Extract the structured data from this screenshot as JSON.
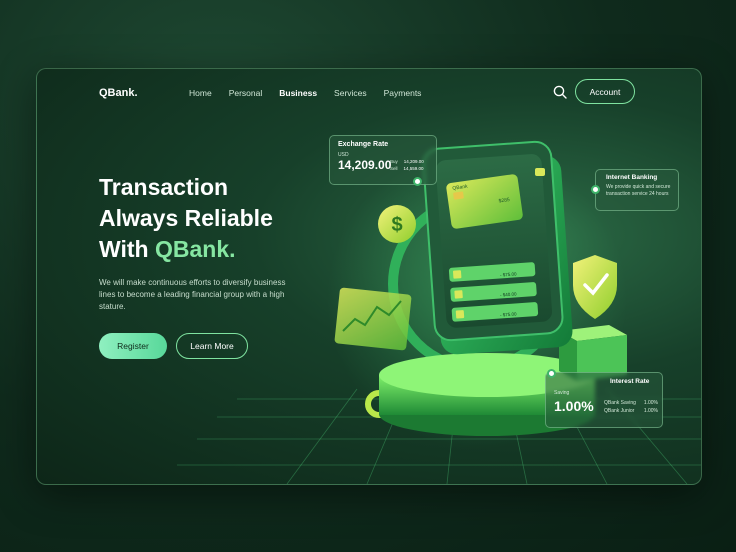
{
  "nav": {
    "logo": "QBank.",
    "items": [
      "Home",
      "Personal",
      "Business",
      "Services",
      "Payments"
    ],
    "active": "Business",
    "account_label": "Account"
  },
  "hero": {
    "title_line1": "Transaction",
    "title_line2": "Always Reliable",
    "title_line3_prefix": "With ",
    "title_line3_accent": "QBank.",
    "description": "We will make continuous efforts to diversify business lines to become a leading financial group with a high stature.",
    "register_label": "Register",
    "learn_more_label": "Learn More"
  },
  "exchange_card": {
    "title": "Exchange Rate",
    "currency": "USD",
    "value": "14,209.00",
    "buy_label": "Buy",
    "buy_value": "14,209.00",
    "sell_label": "Sell",
    "sell_value": "14,559.00"
  },
  "internet_banking": {
    "title": "Internet Banking",
    "description": "We provide quick and secure transaction service 24 hours"
  },
  "interest_rate": {
    "title": "Interest Rate",
    "label": "Saving",
    "value": "1.00%",
    "rows": [
      {
        "name": "QBank Saving",
        "rate": "1.00%"
      },
      {
        "name": "QBank Junior",
        "rate": "1.00%"
      }
    ]
  },
  "phone": {
    "card_brand": "QBank",
    "transactions": [
      "- $75.00",
      "- $40.00",
      "- $75.00"
    ]
  },
  "colors": {
    "accent": "#86e6a2",
    "background": "#0f2a1c",
    "button_gradient_start": "#8ff0c0",
    "button_gradient_end": "#58d89a"
  },
  "icons": [
    "search-icon",
    "dollar-coin-icon",
    "shield-check-icon",
    "chart-icon"
  ]
}
